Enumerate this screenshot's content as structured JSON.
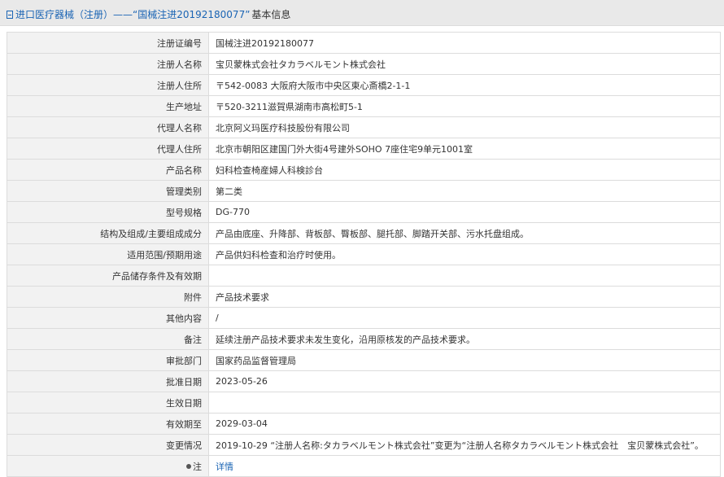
{
  "header": {
    "title": "进口医疗器械（注册）——“国械注进20192180077”",
    "suffix": "基本信息"
  },
  "rows": [
    {
      "label": "注册证编号",
      "value": "国械注进20192180077"
    },
    {
      "label": "注册人名称",
      "value": "宝贝蒙株式会社タカラベルモント株式会社"
    },
    {
      "label": "注册人住所",
      "value": "〒542-0083 大阪府大阪市中央区東心斎橋2-1-1"
    },
    {
      "label": "生产地址",
      "value": "〒520-3211滋賀県湖南市高松町5-1"
    },
    {
      "label": "代理人名称",
      "value": "北京阿义玛医疗科技股份有限公司"
    },
    {
      "label": "代理人住所",
      "value": "北京市朝阳区建国门外大街4号建外SOHO 7座住宅9单元1001室"
    },
    {
      "label": "产品名称",
      "value": "妇科检查椅産婦人科検診台"
    },
    {
      "label": "管理类别",
      "value": "第二类"
    },
    {
      "label": "型号规格",
      "value": "DG-770"
    },
    {
      "label": "结构及组成/主要组成成分",
      "value": "产品由底座、升降部、背板部、臀板部、腿托部、脚踏开关部、污水托盘组成。"
    },
    {
      "label": "适用范围/预期用途",
      "value": "产品供妇科检查和治疗时使用。"
    },
    {
      "label": "产品储存条件及有效期",
      "value": ""
    },
    {
      "label": "附件",
      "value": "产品技术要求"
    },
    {
      "label": "其他内容",
      "value": "/"
    },
    {
      "label": "备注",
      "value": "延续注册产品技术要求未发生变化，沿用原核发的产品技术要求。"
    },
    {
      "label": "审批部门",
      "value": "国家药品监督管理局"
    },
    {
      "label": "批准日期",
      "value": "2023-05-26"
    },
    {
      "label": "生效日期",
      "value": ""
    },
    {
      "label": "有效期至",
      "value": "2029-03-04"
    },
    {
      "label": "变更情况",
      "value": "2019-10-29 “注册人名称:タカラベルモント株式会社”变更为“注册人名称タカラベルモント株式会社　宝贝蒙株式会社”。"
    }
  ],
  "note": {
    "label": "注",
    "link": "详情"
  },
  "colors": {
    "header_bg": "#e9e9e9",
    "link": "#1a64b4",
    "label_bg": "#f2f2f2",
    "border": "#dcdcdc"
  }
}
